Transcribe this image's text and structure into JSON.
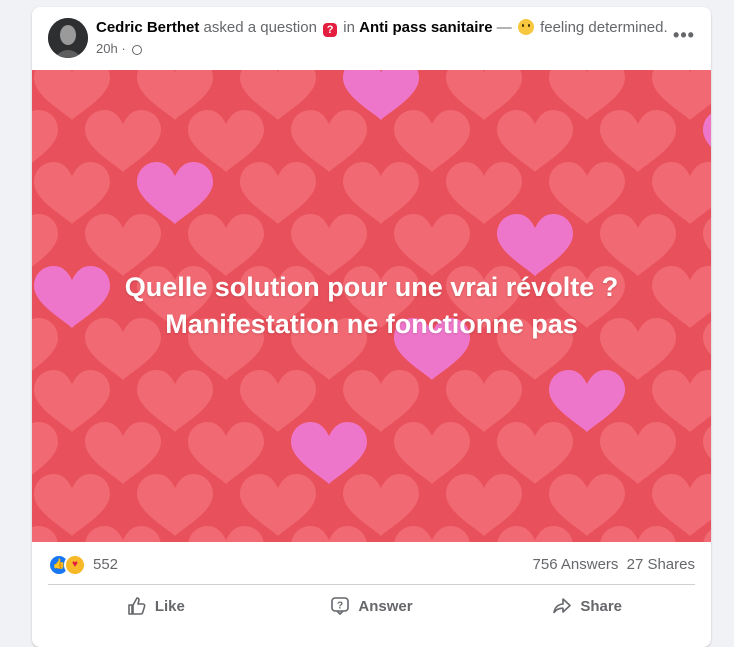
{
  "post": {
    "author": "Cedric Berthet",
    "asked_text": "asked a question",
    "in_text": "in",
    "group": "Anti pass sanitaire",
    "dash": "—",
    "feeling": "feeling determined.",
    "time": "20h",
    "dot": "·",
    "more_label": "•••"
  },
  "question": {
    "line1": "Quelle solution pour une vrai révolte ?",
    "line2": "Manifestation ne fonctionne pas",
    "background": "#e8505b"
  },
  "stats": {
    "reaction_count": "552",
    "answers": "756 Answers",
    "shares": "27 Shares"
  },
  "actions": {
    "like": "Like",
    "answer": "Answer",
    "share": "Share"
  },
  "icons": {
    "question": "question-icon",
    "feeling": "smiling-face-icon",
    "privacy": "globe-icon",
    "like_reaction": "thumbs-up-icon",
    "care_reaction": "care-icon"
  },
  "colors": {
    "accent": "#1877f2",
    "heart_red": "#f26c74",
    "heart_pink": "#ee7ad6",
    "muted_text": "#65676b"
  }
}
